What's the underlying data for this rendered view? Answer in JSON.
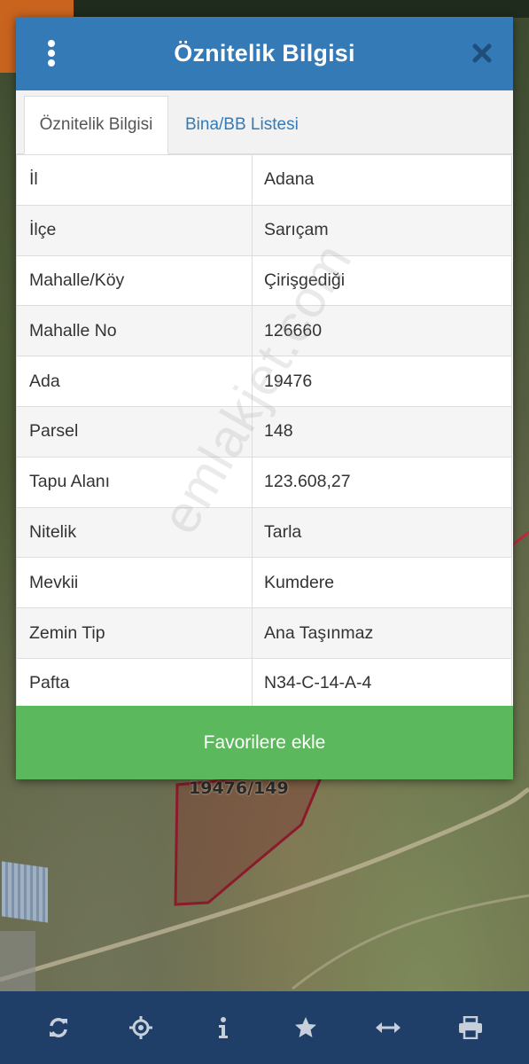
{
  "modal": {
    "title": "Öznitelik Bilgisi",
    "tabs": [
      {
        "label": "Öznitelik Bilgisi",
        "active": true
      },
      {
        "label": "Bina/BB Listesi",
        "active": false
      }
    ],
    "rows": [
      {
        "key": "İl",
        "value": "Adana"
      },
      {
        "key": "İlçe",
        "value": "Sarıçam"
      },
      {
        "key": "Mahalle/Köy",
        "value": "Çirişgediği"
      },
      {
        "key": "Mahalle No",
        "value": "126660"
      },
      {
        "key": "Ada",
        "value": "19476"
      },
      {
        "key": "Parsel",
        "value": "148"
      },
      {
        "key": "Tapu Alanı",
        "value": "123.608,27"
      },
      {
        "key": "Nitelik",
        "value": "Tarla"
      },
      {
        "key": "Mevkii",
        "value": "Kumdere"
      },
      {
        "key": "Zemin Tip",
        "value": "Ana Taşınmaz"
      },
      {
        "key": "Pafta",
        "value": "N34-C-14-A-4"
      }
    ],
    "favorite_button": "Favorilere ekle",
    "watermark": "emlakjet.com"
  },
  "map": {
    "parcel_label": "19476/149"
  },
  "toolbar": {
    "items": [
      "refresh-icon",
      "locate-icon",
      "info-icon",
      "star-icon",
      "measure-icon",
      "print-icon"
    ]
  },
  "colors": {
    "header": "#337ab7",
    "button": "#5cb85c",
    "toolbar": "#1f3e68",
    "parcel_border": "#8b1a2b"
  }
}
